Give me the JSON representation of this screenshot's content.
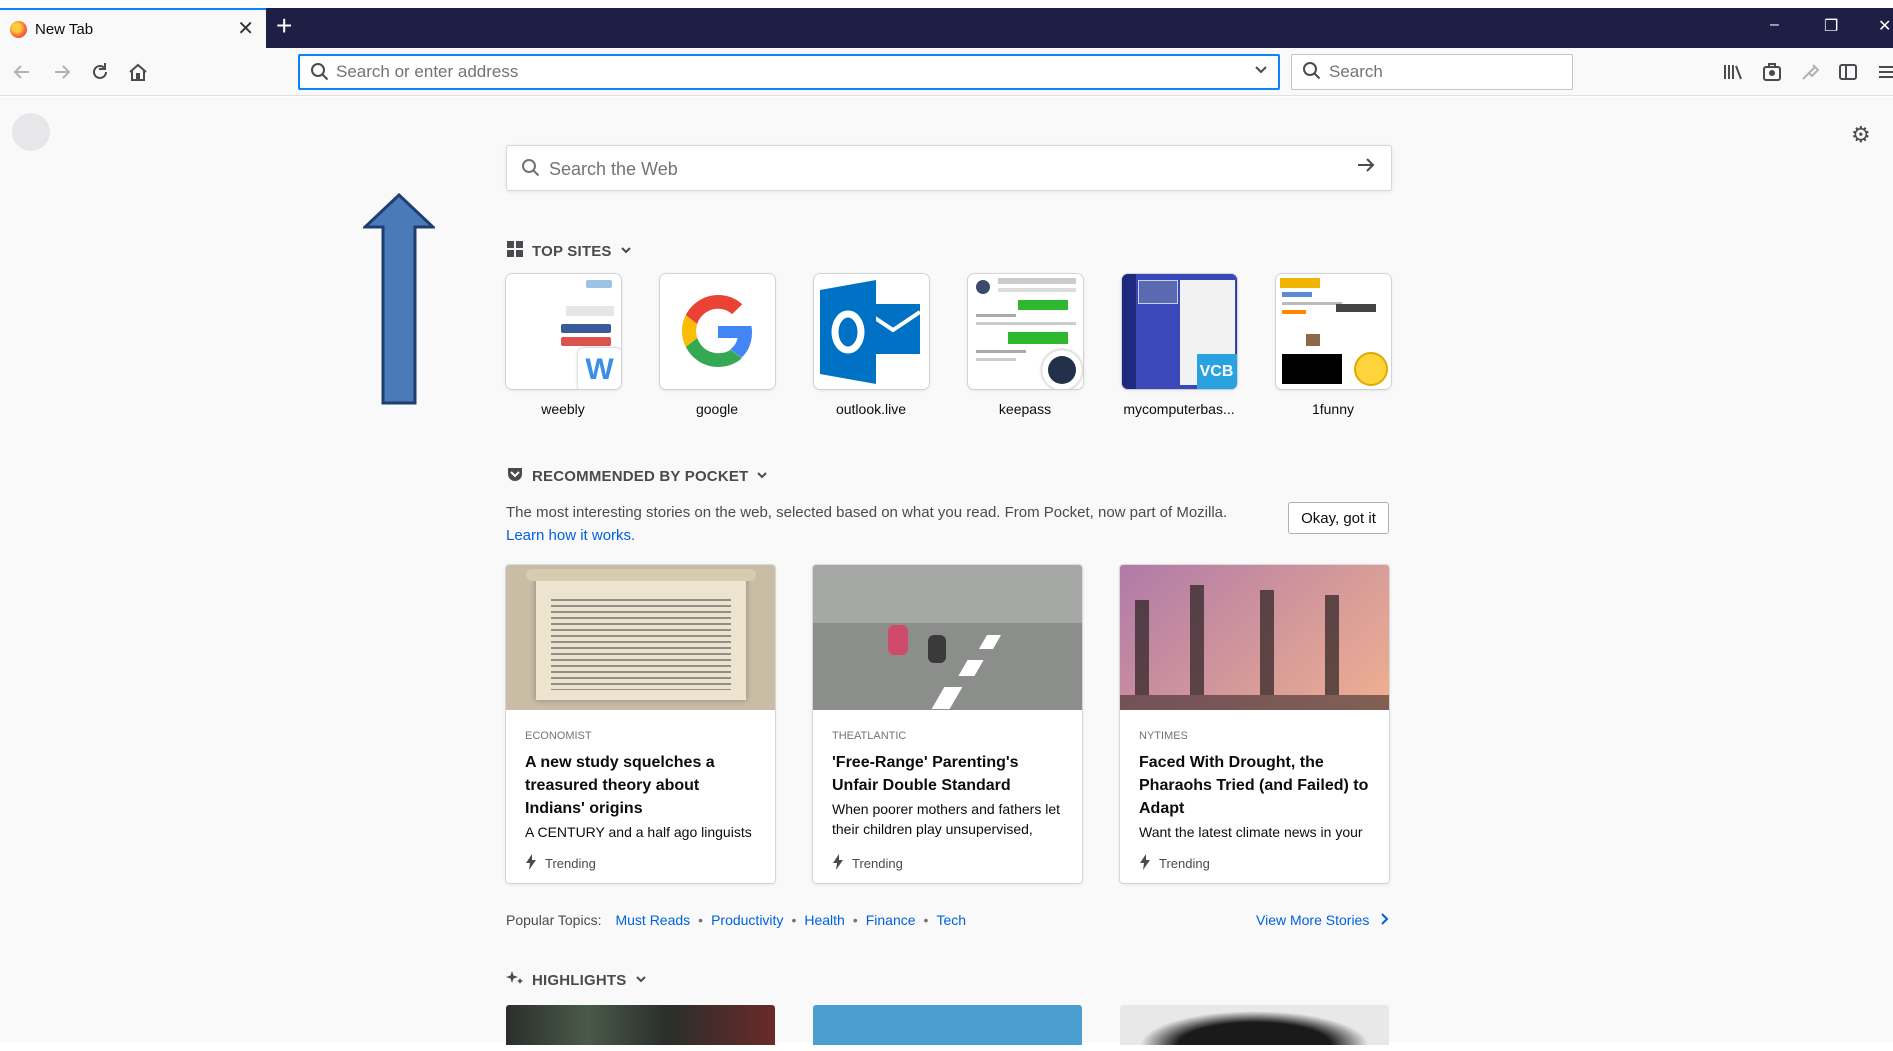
{
  "tab": {
    "title": "New Tab"
  },
  "window": {
    "minimize": "–",
    "restore": "❐",
    "close": "✕"
  },
  "urlbar": {
    "placeholder": "Search or enter address"
  },
  "searchbar": {
    "placeholder": "Search"
  },
  "websearch": {
    "placeholder": "Search the Web"
  },
  "top_sites": {
    "title": "TOP SITES",
    "sites": [
      {
        "label": "weebly"
      },
      {
        "label": "google"
      },
      {
        "label": "outlook.live"
      },
      {
        "label": "keepass"
      },
      {
        "label": "mycomputerbas..."
      },
      {
        "label": "1funny"
      }
    ]
  },
  "pocket": {
    "title": "RECOMMENDED BY POCKET",
    "description": "The most interesting stories on the web, selected based on what you read. From Pocket, now part of Mozilla.",
    "learn_link": "Learn how it works.",
    "okay_button": "Okay, got it",
    "cards": [
      {
        "source": "ECONOMIST",
        "title": "A new study squelches a treasured theory about Indians' origins",
        "excerpt": "A CENTURY and a half ago linguists",
        "context": "Trending"
      },
      {
        "source": "THEATLANTIC",
        "title": "'Free-Range' Parenting's Unfair Double Standard",
        "excerpt": "When poorer mothers and fathers let their children play unsupervised,",
        "context": "Trending"
      },
      {
        "source": "NYTIMES",
        "title": "Faced With Drought, the Pharaohs Tried (and Failed) to Adapt",
        "excerpt": "Want the latest climate news in your",
        "context": "Trending"
      }
    ],
    "topics_label": "Popular Topics:",
    "topics": [
      "Must Reads",
      "Productivity",
      "Health",
      "Finance",
      "Tech"
    ],
    "view_more": "View More Stories"
  },
  "highlights": {
    "title": "HIGHLIGHTS"
  },
  "colors": {
    "accent": "#0a84ff",
    "link": "#0060df",
    "titlebar": "#1d2044",
    "arrow": "#4a7ab8"
  }
}
